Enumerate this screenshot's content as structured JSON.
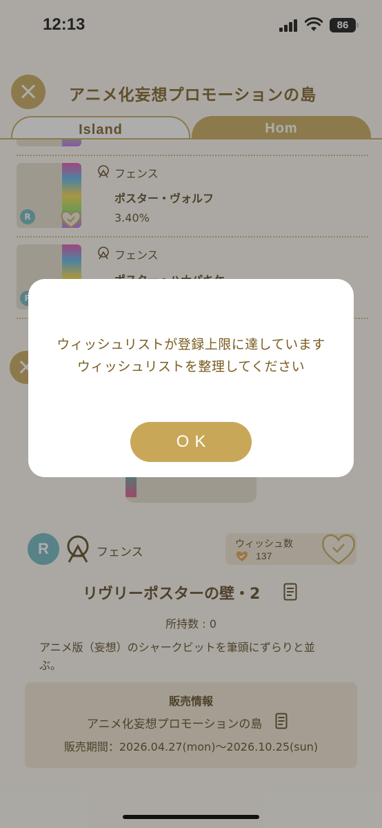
{
  "status_bar": {
    "time": "12:13",
    "battery": "86"
  },
  "header": {
    "title": "アニメ化妄想プロモーションの島"
  },
  "tabs": [
    {
      "label": "Island"
    },
    {
      "label": "Hom"
    }
  ],
  "list": {
    "items": [
      {
        "category": "フェンス",
        "name": "ポスター・ヴォルフ",
        "rate": "3.40%",
        "badge": "R"
      },
      {
        "category": "フェンス",
        "name": "ポスター・ハナパキケ",
        "badge": "R"
      }
    ]
  },
  "detail": {
    "rarity": "R",
    "category": "フェンス",
    "wishlist_label": "ウィッシュ数",
    "wishlist_count": "137",
    "title": "リヴリーポスターの壁・2",
    "owned": "所持数 : 0",
    "description": "アニメ版（妄想）のシャークビットを筆頭にずらりと並ぶ。"
  },
  "sales": {
    "title": "販売情報",
    "island": "アニメ化妄想プロモーションの島",
    "period": "販売期間：2026.04.27(mon)〜2026.10.25(sun)"
  },
  "modal": {
    "line1": "ウィッシュリストが登録上限に達しています",
    "line2": "ウィッシュリストを整理してください",
    "ok": "OK"
  },
  "colors": {
    "accent": "#c8a858",
    "text": "#5a4520",
    "rarity": "#6bb6bf"
  }
}
